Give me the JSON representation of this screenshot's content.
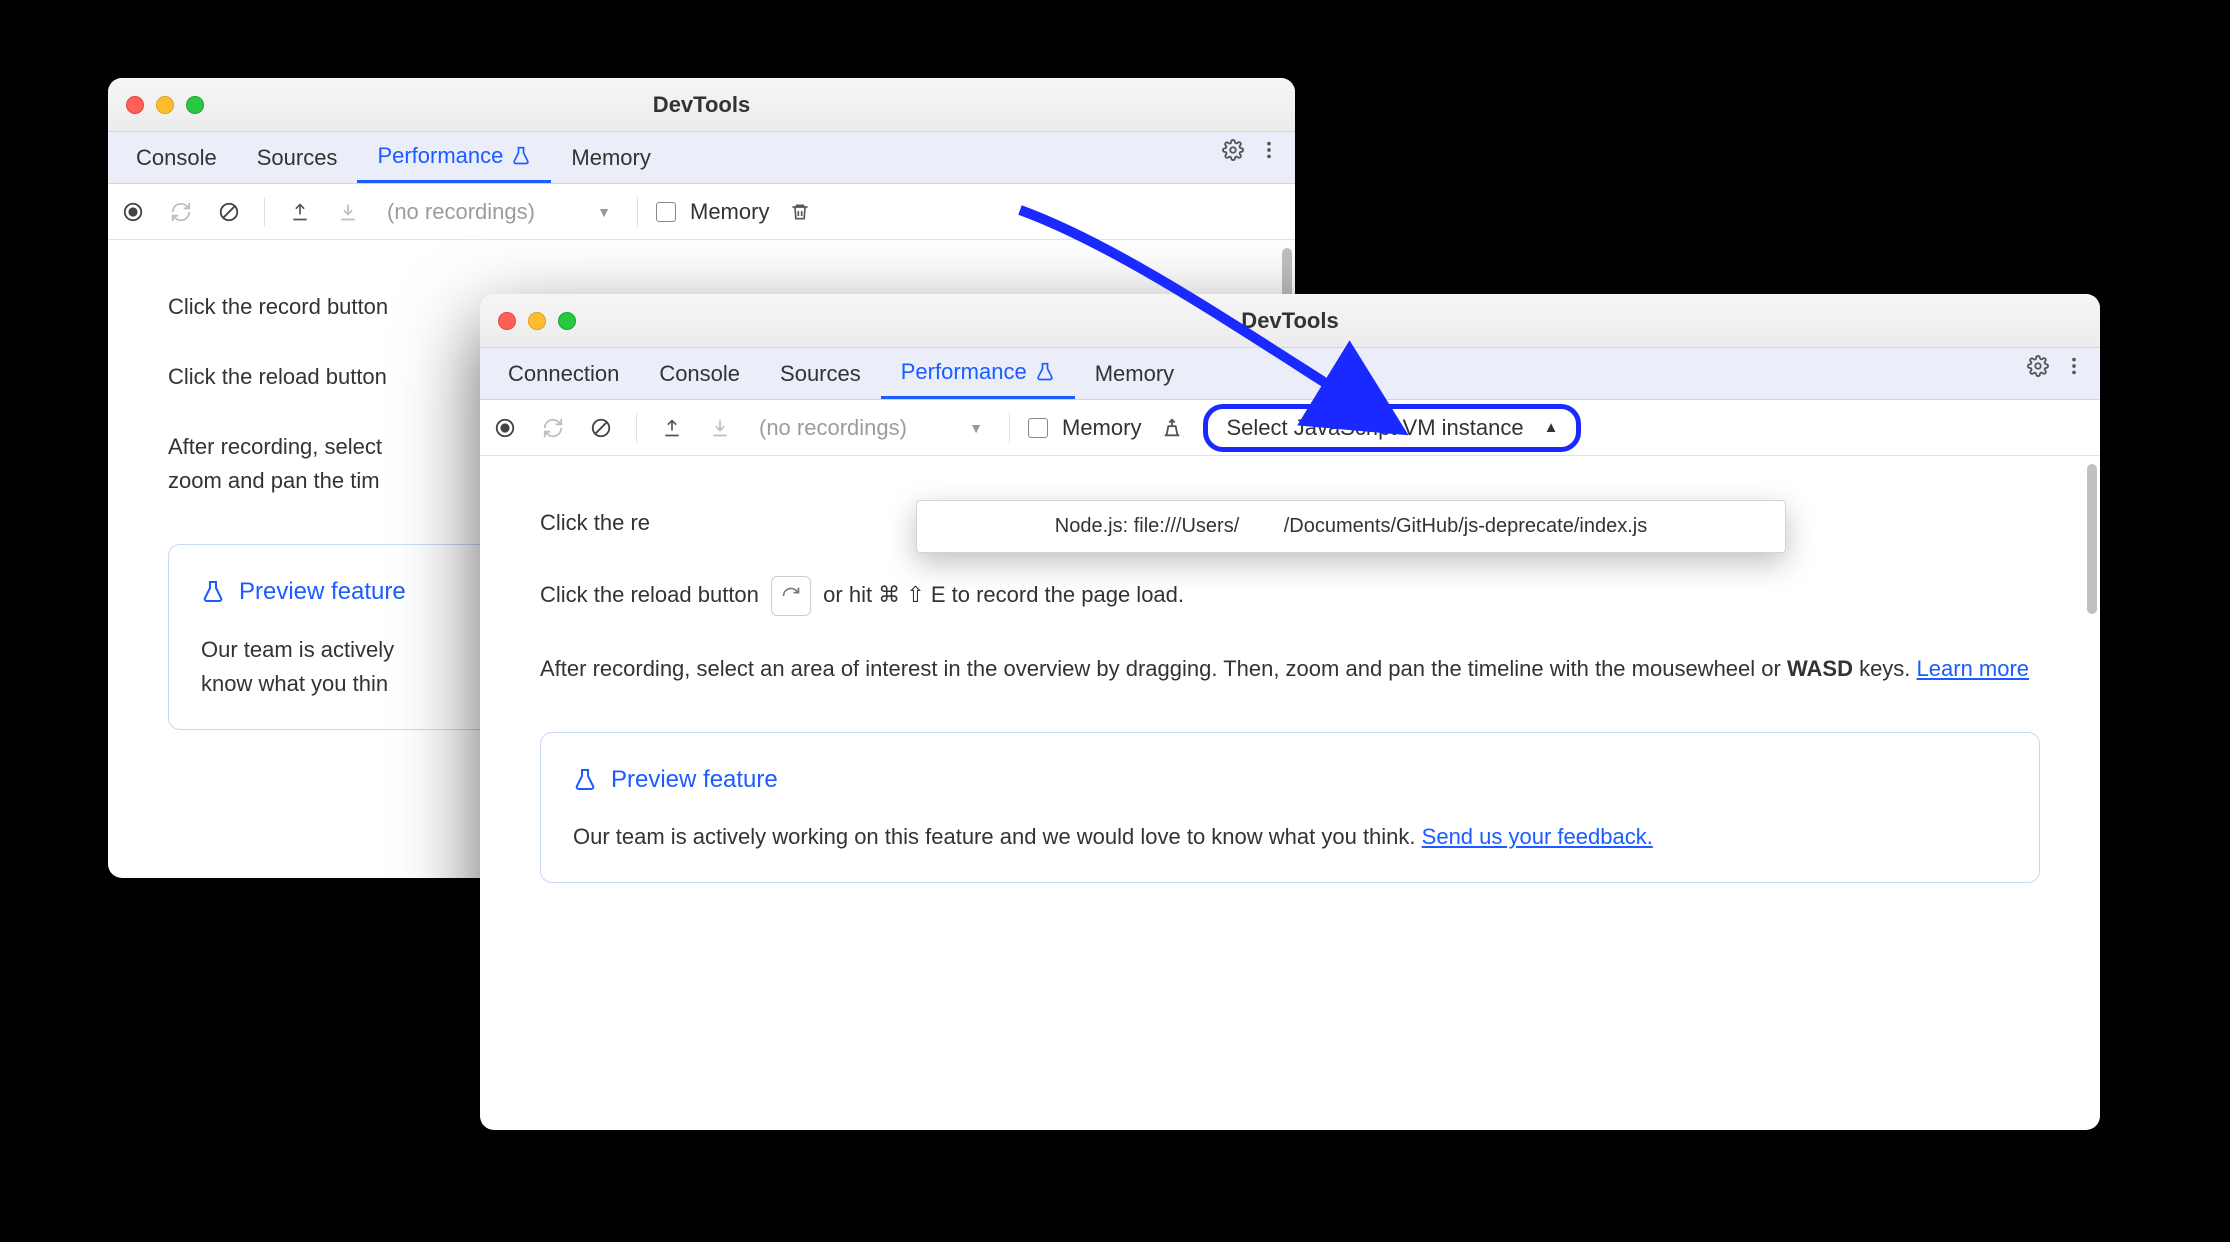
{
  "window_title": "DevTools",
  "win1": {
    "tabs": [
      "Console",
      "Sources",
      "Performance",
      "Memory"
    ],
    "active_tab": "Performance",
    "recording_label": "(no recordings)",
    "memory_label": "Memory",
    "instr_record": "Click the record button",
    "instr_reload": "Click the reload button",
    "instr_after_1": "After recording, select",
    "instr_after_2": "zoom and pan the tim",
    "preview_title": "Preview feature",
    "preview_body_1": "Our team is actively",
    "preview_body_2": "know what you thin"
  },
  "win2": {
    "tabs": [
      "Connection",
      "Console",
      "Sources",
      "Performance",
      "Memory"
    ],
    "active_tab": "Performance",
    "recording_label": "(no recordings)",
    "memory_label": "Memory",
    "vm_label": "Select JavaScript VM instance",
    "dd_item_a": "Node.js: file:///Users/",
    "dd_item_b": "/Documents/GitHub/js-deprecate/index.js",
    "instr_record_pre": "Click the re",
    "instr_reload_pre": "Click the reload button ",
    "instr_reload_post": " or hit ⌘ ⇧ E to record the page load.",
    "instr_after": "After recording, select an area of interest in the overview by dragging. Then, zoom and pan the timeline with the mousewheel or ",
    "wasd": "WASD",
    "keys": " keys. ",
    "learn_more": "Learn more",
    "preview_title": "Preview feature",
    "preview_body": "Our team is actively working on this feature and we would love to know what you think. ",
    "feedback": "Send us your feedback."
  }
}
